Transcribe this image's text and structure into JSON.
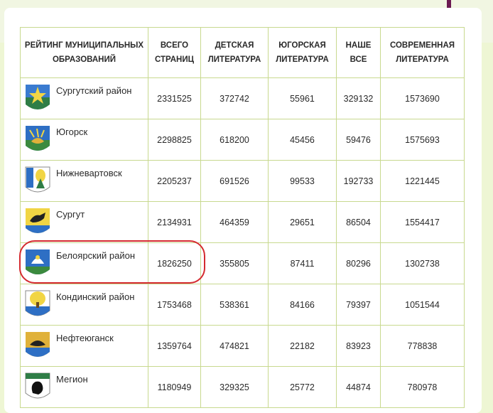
{
  "table": {
    "headers": {
      "rating": "РЕЙТИНГ МУНИЦИПАЛЬНЫХ ОБРАЗОВАНИЙ",
      "total": "ВСЕГО СТРАНИЦ",
      "kids": "ДЕТСКАЯ ЛИТЕРАТУРА",
      "yugra": "ЮГОРСКАЯ ЛИТЕРАТУРА",
      "ours": "НАШЕ ВСЕ",
      "modern": "СОВРЕМЕННАЯ ЛИТЕРАТУРА"
    },
    "rows": [
      {
        "name": "Сургутский район",
        "emblem": "surgut-district-emblem",
        "total": "2331525",
        "kids": "372742",
        "yugra": "55961",
        "ours": "329132",
        "modern": "1573690"
      },
      {
        "name": "Югорск",
        "emblem": "yugorsk-emblem",
        "total": "2298825",
        "kids": "618200",
        "yugra": "45456",
        "ours": "59476",
        "modern": "1575693"
      },
      {
        "name": "Нижневартовск",
        "emblem": "nizhnevartovsk-emblem",
        "total": "2205237",
        "kids": "691526",
        "yugra": "99533",
        "ours": "192733",
        "modern": "1221445"
      },
      {
        "name": "Сургут",
        "emblem": "surgut-emblem",
        "total": "2134931",
        "kids": "464359",
        "yugra": "29651",
        "ours": "86504",
        "modern": "1554417"
      },
      {
        "name": "Белоярский район",
        "emblem": "beloyarsky-district-emblem",
        "total": "1826250",
        "kids": "355805",
        "yugra": "87411",
        "ours": "80296",
        "modern": "1302738"
      },
      {
        "name": "Кондинский район",
        "emblem": "kondinsky-district-emblem",
        "total": "1753468",
        "kids": "538361",
        "yugra": "84166",
        "ours": "79397",
        "modern": "1051544"
      },
      {
        "name": "Нефтеюганск",
        "emblem": "nefteyugansk-emblem",
        "total": "1359764",
        "kids": "474821",
        "yugra": "22182",
        "ours": "83923",
        "modern": "778838"
      },
      {
        "name": "Мегион",
        "emblem": "megion-emblem",
        "total": "1180949",
        "kids": "329325",
        "yugra": "25772",
        "ours": "44874",
        "modern": "780978"
      }
    ]
  },
  "highlight_row": "Белоярский район",
  "colors": {
    "border": "#c8d98f",
    "highlight": "#d42a2f",
    "accent": "#6b1a52",
    "page_bg": "#eef6d4"
  }
}
